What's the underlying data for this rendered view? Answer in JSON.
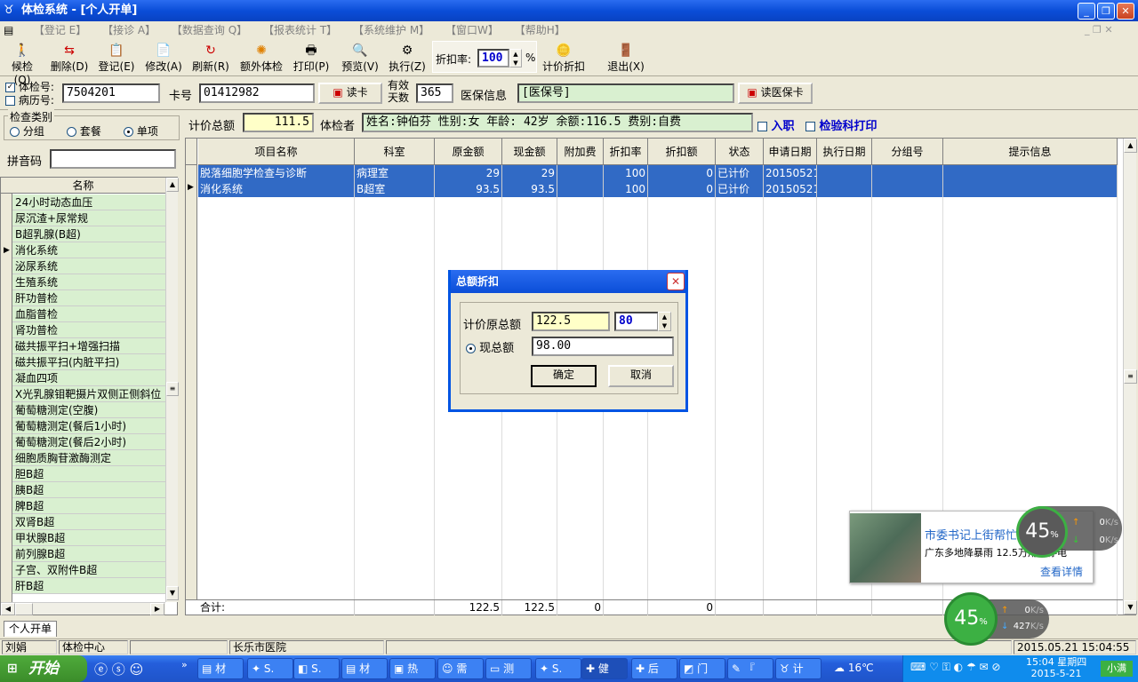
{
  "window": {
    "title": "体检系统 - [个人开单]"
  },
  "menu": [
    "【登记 E】",
    "【接诊 A】",
    "【数据查询 Q】",
    "【报表统计 T】",
    "【系统维护 M】",
    "【窗口W】",
    "【帮助H】"
  ],
  "toolbar": {
    "buttons": [
      "候检(Q)",
      "删除(D)",
      "登记(E)",
      "修改(A)",
      "刷新(R)",
      "额外体检",
      "打印(P)",
      "预览(V)",
      "执行(Z)"
    ],
    "discount_label": "折扣率:",
    "discount_value": "100",
    "percent": "%",
    "price_discount": "计价折扣",
    "exit": "退出(X)"
  },
  "idrow": {
    "checkup_no_label": "体检号:",
    "record_no_label": "病历号:",
    "checkup_no": "7504201",
    "card_label": "卡号",
    "card_no": "01412982",
    "read_card": "读卡",
    "valid_days_label1": "有效",
    "valid_days_label2": "天数",
    "valid_days": "365",
    "insurance_label": "医保信息",
    "insurance_value": "[医保号]",
    "read_insurance": "读医保卡"
  },
  "category": {
    "label": "检查类别",
    "options": [
      "分组",
      "套餐",
      "单项"
    ],
    "selected": "单项"
  },
  "pinyin_label": "拼音码",
  "list": {
    "header": "名称",
    "items": [
      "24小时动态血压",
      "尿沉渣+尿常规",
      "B超乳腺(B超)",
      "消化系统",
      "泌尿系统",
      "生殖系统",
      "肝功普检",
      "血脂普检",
      "肾功普检",
      "磁共振平扫+增强扫描",
      "磁共振平扫(内脏平扫)",
      "凝血四项",
      "X光乳腺钼靶摄片双侧正侧斜位",
      "葡萄糖测定(空腹)",
      "葡萄糖测定(餐后1小时)",
      "葡萄糖测定(餐后2小时)",
      "细胞质胸苷激酶测定",
      "胆B超",
      "胰B超",
      "脾B超",
      "双肾B超",
      "甲状腺B超",
      "前列腺B超",
      "子宫、双附件B超",
      "肝B超"
    ],
    "current": "消化系统"
  },
  "summary": {
    "total_label": "计价总额",
    "total_value": "111.5",
    "patient_label": "体检者",
    "patient_info": "姓名:钟伯芬 性别:女 年龄: 42岁 余额:116.5 费别:自费",
    "enroll": "入职",
    "lab_print": "检验科打印"
  },
  "grid": {
    "columns": [
      "项目名称",
      "科室",
      "原金额",
      "现金额",
      "附加费",
      "折扣率",
      "折扣额",
      "状态",
      "申请日期",
      "执行日期",
      "分组号",
      "提示信息"
    ],
    "rows": [
      [
        "脱落细胞学检查与诊断",
        "病理室",
        "29",
        "29",
        "",
        "100",
        "0",
        "已计价",
        "20150521",
        "",
        "",
        ""
      ],
      [
        "消化系统",
        "B超室",
        "93.5",
        "93.5",
        "",
        "100",
        "0",
        "已计价",
        "20150521",
        "",
        "",
        ""
      ]
    ],
    "footer": [
      "合计:",
      "",
      "122.5",
      "122.5",
      "0",
      "",
      "0",
      "",
      "",
      "",
      "",
      ""
    ]
  },
  "dialog": {
    "title": "总额折扣",
    "orig_label": "计价原总额",
    "orig_value": "122.5",
    "rate": "80",
    "cur_label": "现总额",
    "cur_value": "98.00",
    "ok": "确定",
    "cancel": "取消"
  },
  "tab": "个人开单",
  "status": [
    "刘娟",
    "体检中心",
    "",
    "长乐市医院",
    "",
    "2015.05.21 15:04:55"
  ],
  "notification": {
    "title": "市委书记上街帮忙",
    "subtitle": "广东多地降暴雨 12.5万用户停电",
    "link": "查看详情"
  },
  "gauge1": {
    "percent": "45",
    "unit": "%",
    "up": "0",
    "down": "0",
    "speed_unit": "K/s"
  },
  "gauge2": {
    "percent": "45",
    "unit": "%",
    "up": "0",
    "down": "427",
    "speed_unit": "K/s"
  },
  "taskbar": {
    "start": "开始",
    "tasks": [
      "材",
      "S.",
      "S.",
      "材",
      "热",
      "需",
      "测",
      "S.",
      "健",
      "后",
      "门",
      "『",
      "计"
    ],
    "weather": "16℃",
    "time": "15:04",
    "weekday": "星期四",
    "date": "2015-5-21",
    "ime": "小满"
  }
}
